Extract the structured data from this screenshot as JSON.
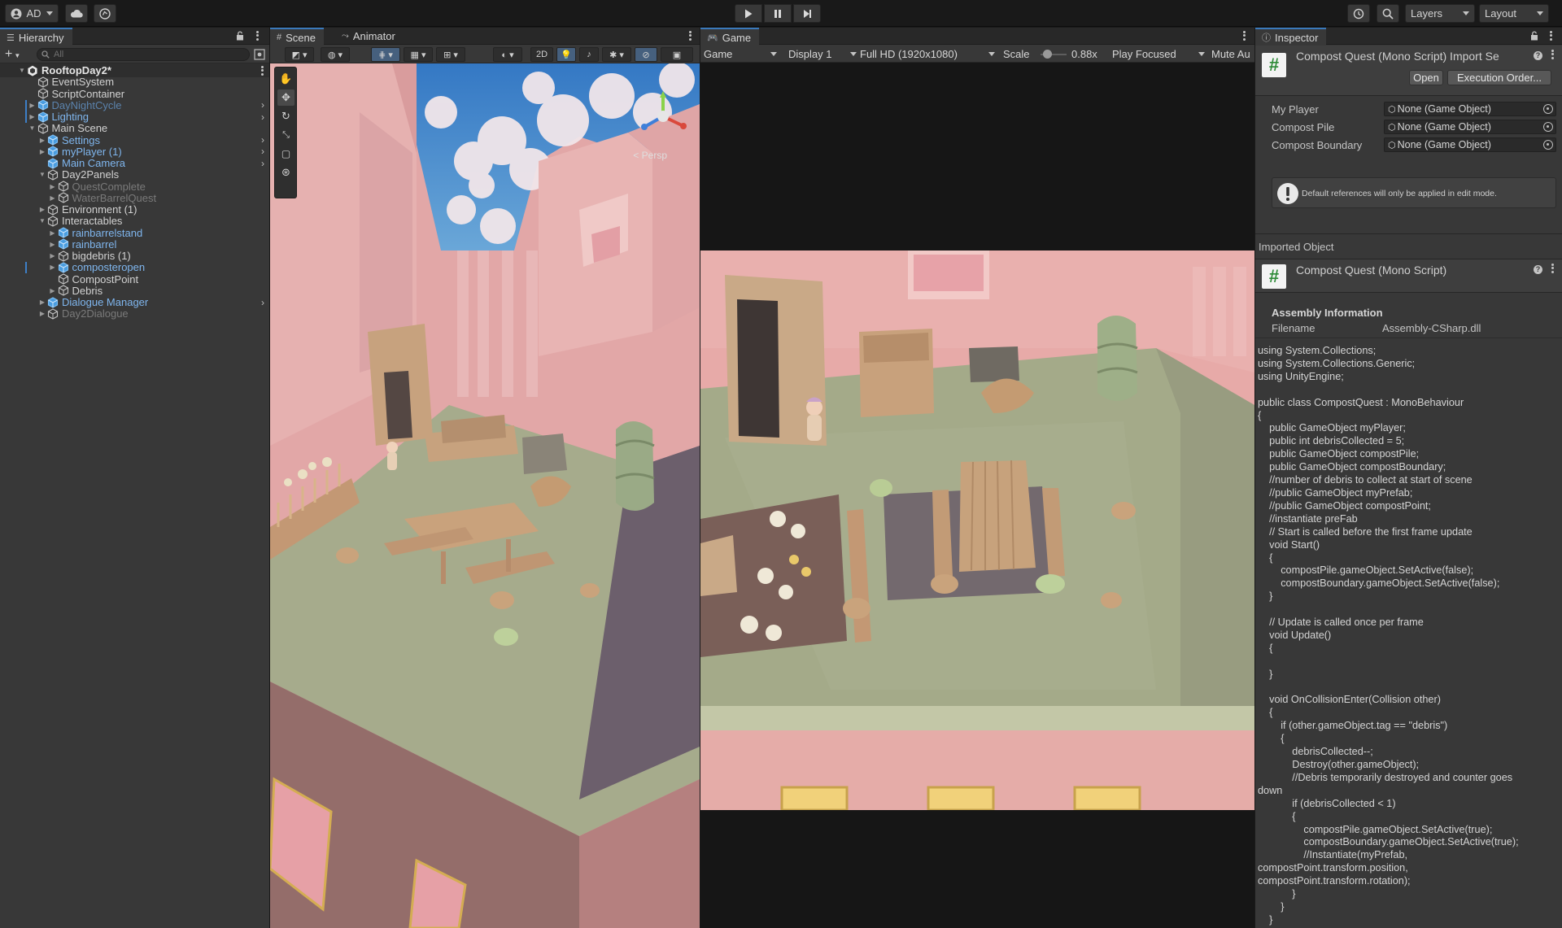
{
  "toolbar": {
    "account_label": "AD",
    "layers_label": "Layers",
    "layout_label": "Layout"
  },
  "hierarchy": {
    "tab_label": "Hierarchy",
    "search_placeholder": "All",
    "items": [
      {
        "label": "RooftopDay2*",
        "depth": 0,
        "type": "scene",
        "expanded": true
      },
      {
        "label": "EventSystem",
        "depth": 1,
        "type": "object"
      },
      {
        "label": "ScriptContainer",
        "depth": 1,
        "type": "object"
      },
      {
        "label": "DayNightCycle",
        "depth": 1,
        "type": "prefab-disabled",
        "collapsed": true,
        "chevron": true,
        "bar": true
      },
      {
        "label": "Lighting",
        "depth": 1,
        "type": "prefab",
        "collapsed": true,
        "chevron": true,
        "bar": true
      },
      {
        "label": "Main Scene",
        "depth": 1,
        "type": "object",
        "expanded": true
      },
      {
        "label": "Settings",
        "depth": 2,
        "type": "prefab",
        "collapsed": true,
        "chevron": true
      },
      {
        "label": "myPlayer (1)",
        "depth": 2,
        "type": "prefab",
        "collapsed": true,
        "chevron": true
      },
      {
        "label": "Main Camera",
        "depth": 2,
        "type": "prefab",
        "chevron": true
      },
      {
        "label": "Day2Panels",
        "depth": 2,
        "type": "object",
        "expanded": true
      },
      {
        "label": "QuestComplete",
        "depth": 3,
        "type": "disabled",
        "collapsed": true
      },
      {
        "label": "WaterBarrelQuest",
        "depth": 3,
        "type": "disabled",
        "collapsed": true
      },
      {
        "label": "Environment (1)",
        "depth": 2,
        "type": "object",
        "collapsed": true
      },
      {
        "label": "Interactables",
        "depth": 2,
        "type": "object",
        "expanded": true
      },
      {
        "label": "rainbarrelstand",
        "depth": 3,
        "type": "prefab",
        "collapsed": true
      },
      {
        "label": "rainbarrel",
        "depth": 3,
        "type": "prefab",
        "collapsed": true
      },
      {
        "label": "bigdebris (1)",
        "depth": 3,
        "type": "object",
        "collapsed": true
      },
      {
        "label": "composteropen",
        "depth": 3,
        "type": "prefab",
        "collapsed": true,
        "bar": true
      },
      {
        "label": "CompostPoint",
        "depth": 3,
        "type": "object"
      },
      {
        "label": "Debris",
        "depth": 3,
        "type": "object",
        "collapsed": true
      },
      {
        "label": "Dialogue Manager",
        "depth": 2,
        "type": "prefab",
        "collapsed": true,
        "chevron": true
      },
      {
        "label": "Day2Dialogue",
        "depth": 2,
        "type": "disabled",
        "collapsed": true
      }
    ]
  },
  "scene": {
    "tab_label": "Scene",
    "animator_tab_label": "Animator",
    "mode_2d_label": "2D",
    "persp_label": "< Persp"
  },
  "game": {
    "tab_label": "Game",
    "view_label": "Game",
    "display_label": "Display 1",
    "resolution_label": "Full HD (1920x1080)",
    "scale_label": "Scale",
    "scale_value": "0.88x",
    "scale_fraction": 0.12,
    "play_focused_label": "Play Focused",
    "mute_label": "Mute Au"
  },
  "inspector": {
    "tab_label": "Inspector",
    "header_title": "Compost Quest (Mono Script) Import Se",
    "open_label": "Open",
    "execution_order_label": "Execution Order...",
    "fields": [
      {
        "label": "My Player",
        "value": "None (Game Object)"
      },
      {
        "label": "Compost Pile",
        "value": "None (Game Object)"
      },
      {
        "label": "Compost Boundary",
        "value": "None (Game Object)"
      }
    ],
    "warning_text": "Default references will only be applied in edit mode.",
    "imported_object_label": "Imported Object",
    "imported_title": "Compost Quest (Mono Script)",
    "assembly_information_label": "Assembly Information",
    "filename_label": "Filename",
    "filename_value": "Assembly-CSharp.dll",
    "code": "using System.Collections;\nusing System.Collections.Generic;\nusing UnityEngine;\n\npublic class CompostQuest : MonoBehaviour\n{\n    public GameObject myPlayer;\n    public int debrisCollected = 5;\n    public GameObject compostPile;\n    public GameObject compostBoundary;\n    //number of debris to collect at start of scene\n    //public GameObject myPrefab;\n    //public GameObject compostPoint;\n    //instantiate preFab\n    // Start is called before the first frame update\n    void Start()\n    {\n        compostPile.gameObject.SetActive(false);\n        compostBoundary.gameObject.SetActive(false);\n    }\n\n    // Update is called once per frame\n    void Update()\n    {\n\n    }\n\n    void OnCollisionEnter(Collision other)\n    {\n        if (other.gameObject.tag == \"debris\")\n        {\n            debrisCollected--;\n            Destroy(other.gameObject);\n            //Debris temporarily destroyed and counter goes\ndown\n            if (debrisCollected < 1)\n            {\n                compostPile.gameObject.SetActive(true);\n                compostBoundary.gameObject.SetActive(true);\n                //Instantiate(myPrefab,\ncompostPoint.transform.position,\ncompostPoint.transform.rotation);\n            }\n        }\n    }\n}"
  },
  "colors": {
    "accent_blue": "#3a79bb",
    "prefab_blue": "#7fb6ee",
    "sky_blue": "#3b84c9",
    "rooftop_pink": "#e6a9a7",
    "floor_green": "#a5aa88"
  }
}
